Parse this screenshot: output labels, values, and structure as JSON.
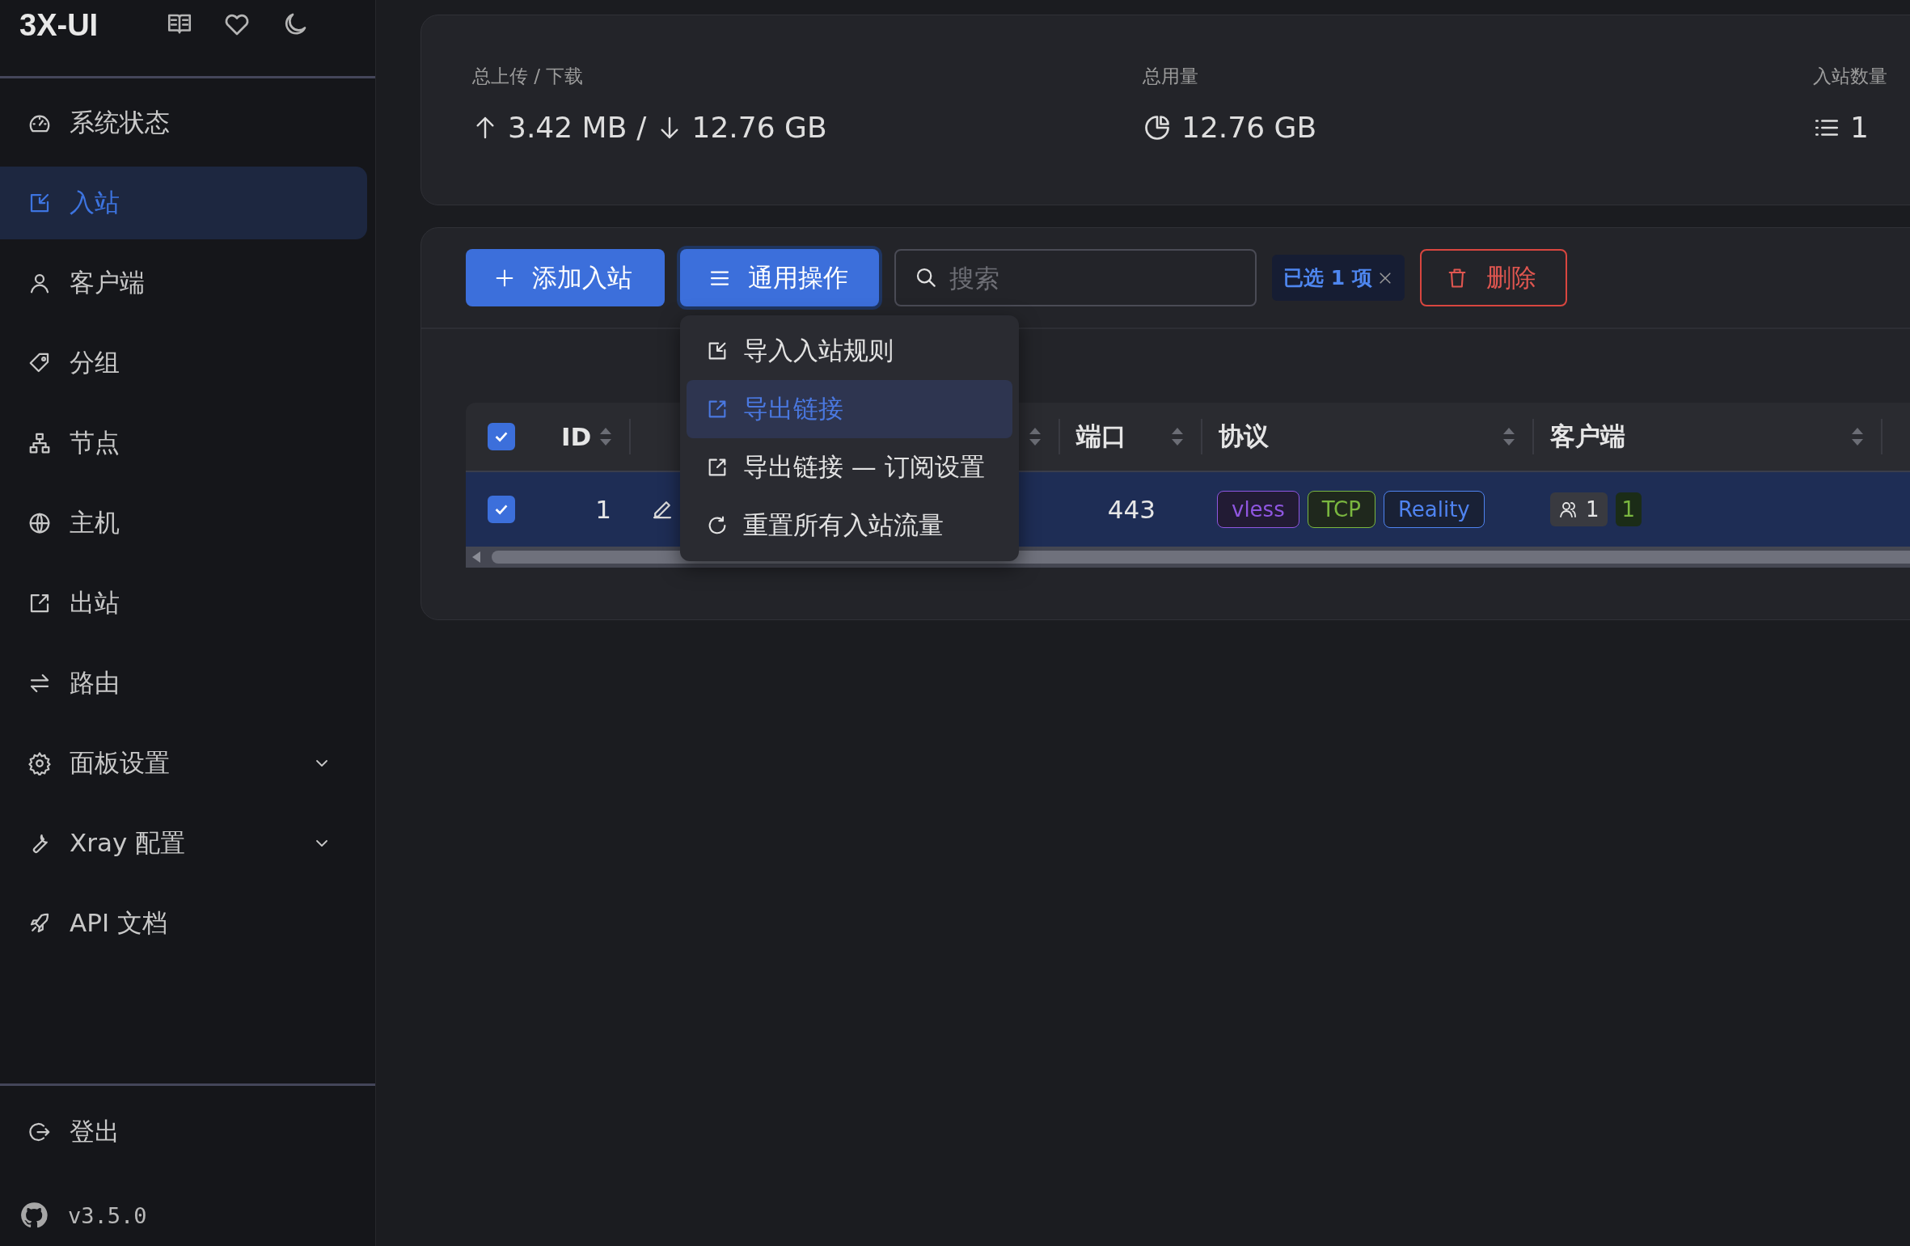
{
  "sidebar": {
    "logo": "3X-UI",
    "items": [
      {
        "label": "系统状态",
        "selected": false,
        "kind": "link"
      },
      {
        "label": "入站",
        "selected": true,
        "kind": "link"
      },
      {
        "label": "客户端",
        "selected": false,
        "kind": "link"
      },
      {
        "label": "分组",
        "selected": false,
        "kind": "link"
      },
      {
        "label": "节点",
        "selected": false,
        "kind": "link"
      },
      {
        "label": "主机",
        "selected": false,
        "kind": "link"
      },
      {
        "label": "出站",
        "selected": false,
        "kind": "link"
      },
      {
        "label": "路由",
        "selected": false,
        "kind": "link"
      },
      {
        "label": "面板设置",
        "selected": false,
        "kind": "submenu"
      },
      {
        "label": "Xray 配置",
        "selected": false,
        "kind": "submenu"
      },
      {
        "label": "API 文档",
        "selected": false,
        "kind": "link"
      }
    ],
    "logout": "登出",
    "version": "v3.5.0"
  },
  "stats": [
    {
      "kind": "traffic",
      "label": "总上传 / 下载",
      "upload": "3.42 MB",
      "separator": "/",
      "download": "12.76 GB"
    },
    {
      "kind": "usage",
      "label": "总用量",
      "value": "12.76 GB"
    },
    {
      "kind": "count",
      "label": "入站数量",
      "value": "1"
    }
  ],
  "toolbar": {
    "add_button": "添加入站",
    "actions_button": "通用操作",
    "search": {
      "placeholder": "搜索"
    },
    "selection": "已选 1 项",
    "delete_button": "删除"
  },
  "actions_menu": [
    {
      "label": "导入入站规则",
      "selected": false
    },
    {
      "label": "导出链接",
      "selected": true
    },
    {
      "label": "导出链接 — 订阅设置",
      "selected": false
    },
    {
      "label": "重置所有入站流量",
      "selected": false
    }
  ],
  "table": {
    "select_all": {
      "checked": true
    },
    "columns": [
      {
        "label": "ID",
        "sortable": true
      },
      {
        "sortable": true
      },
      {
        "label": "端口",
        "sortable": true
      },
      {
        "label": "协议",
        "sortable": true
      },
      {
        "label": "客户端",
        "sortable": true
      }
    ],
    "rows": [
      {
        "selected": true,
        "checked": true,
        "id": "1",
        "port": "443",
        "protocol": [
          {
            "label": "vless",
            "color": "#8f56e0"
          },
          {
            "label": "TCP",
            "color": "#7ab73f"
          },
          {
            "label": "Reality",
            "color": "#4f83f0"
          }
        ],
        "clients": "1",
        "online": "1"
      }
    ]
  }
}
